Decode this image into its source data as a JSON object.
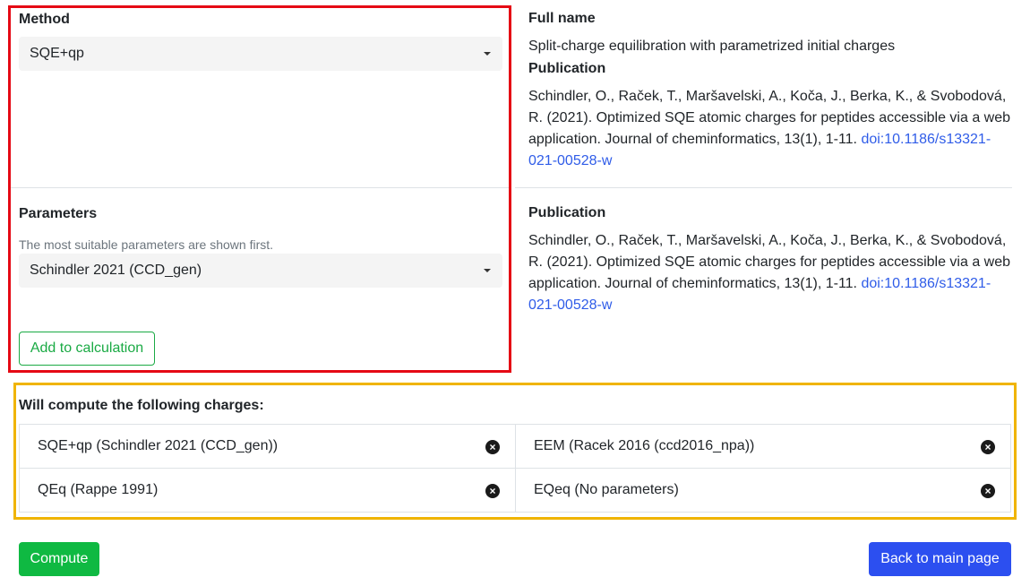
{
  "method": {
    "label": "Method",
    "selected": "SQE+qp"
  },
  "parameters": {
    "label": "Parameters",
    "hint": "The most suitable parameters are shown first.",
    "selected": "Schindler 2021 (CCD_gen)",
    "add_button": "Add to calculation"
  },
  "method_info": {
    "fullname_title": "Full name",
    "fullname": "Split-charge equilibration with parametrized initial charges",
    "publication_title": "Publication",
    "publication_lines": [
      "Schindler, O., Raček, T., Maršavelski, A., Koča, J., Berka, K., & Svobodová,",
      "R. (2021). Optimized SQE atomic charges for peptides accessible via a web",
      "application. Journal of cheminformatics, 13(1), 1-11. "
    ],
    "doi_part1": "doi:10.1186/s13321-",
    "doi_part2": "021-00528-w"
  },
  "param_info": {
    "publication_title": "Publication",
    "publication_lines": [
      "Schindler, O., Raček, T., Maršavelski, A., Koča, J., Berka, K., & Svobodová,",
      "R. (2021). Optimized SQE atomic charges for peptides accessible via a web",
      "application. Journal of cheminformatics, 13(1), 1-11. "
    ],
    "doi_part1": "doi:10.1186/s13321-",
    "doi_part2": "021-00528-w"
  },
  "charges": {
    "title": "Will compute the following charges:",
    "items": [
      "SQE+qp (Schindler 2021 (CCD_gen))",
      "EEM (Racek 2016 (ccd2016_npa))",
      "QEq (Rappe 1991)",
      "EQeq (No parameters)"
    ],
    "remove_symbol": "×"
  },
  "actions": {
    "compute": "Compute",
    "back": "Back to main page"
  },
  "colors": {
    "highlight_red": "#e50914",
    "highlight_yellow": "#f0b400",
    "success": "#0fb942",
    "primary": "#2c4ff0",
    "link": "#2f5ce8"
  }
}
